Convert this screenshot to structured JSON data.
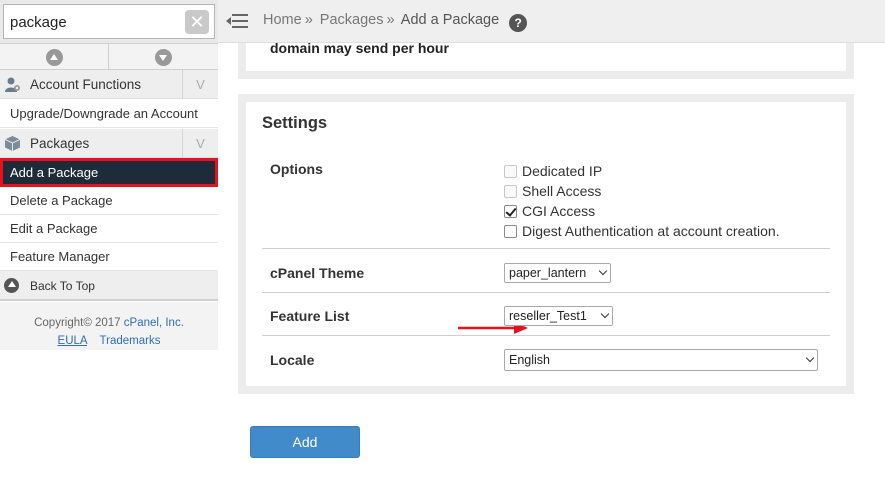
{
  "search": {
    "value": "package",
    "clear_icon": "close-icon"
  },
  "sidebar": {
    "groups": [
      {
        "label": "Account Functions",
        "icon": "user-gear-icon"
      },
      {
        "label": "Packages",
        "icon": "box-icon"
      }
    ],
    "items": [
      {
        "label": "Upgrade/Downgrade an Account"
      },
      {
        "label": "Add a Package"
      },
      {
        "label": "Delete a Package"
      },
      {
        "label": "Edit a Package"
      },
      {
        "label": "Feature Manager"
      }
    ],
    "back_to_top": "Back To Top",
    "footer": {
      "copyright_prefix": "Copyright© 2017",
      "company": "cPanel, Inc.",
      "eula": "EULA",
      "trademarks": "Trademarks"
    },
    "chevron_glyph": "V"
  },
  "header": {
    "breadcrumb": [
      "Home",
      "Packages",
      "Add a Package"
    ],
    "separator": "»",
    "help_glyph": "?"
  },
  "main": {
    "previous_panel_text": "domain may send per hour",
    "settings": {
      "title": "Settings",
      "options_label": "Options",
      "options": [
        {
          "label": "Dedicated IP",
          "checked": false,
          "disabled": true
        },
        {
          "label": "Shell Access",
          "checked": false,
          "disabled": true
        },
        {
          "label": "CGI Access",
          "checked": true,
          "disabled": false
        },
        {
          "label": "Digest Authentication at account creation.",
          "checked": false,
          "disabled": false
        }
      ],
      "theme_label": "cPanel Theme",
      "theme_value": "paper_lantern",
      "feature_list_label": "Feature List",
      "feature_list_value": "reseller_Test1",
      "locale_label": "Locale",
      "locale_value": "English"
    },
    "add_button_label": "Add"
  },
  "colors": {
    "active_nav_bg": "#1e2c3a",
    "highlight_red": "#e8111d",
    "primary_button": "#428bca",
    "link": "#2f6fb3"
  }
}
